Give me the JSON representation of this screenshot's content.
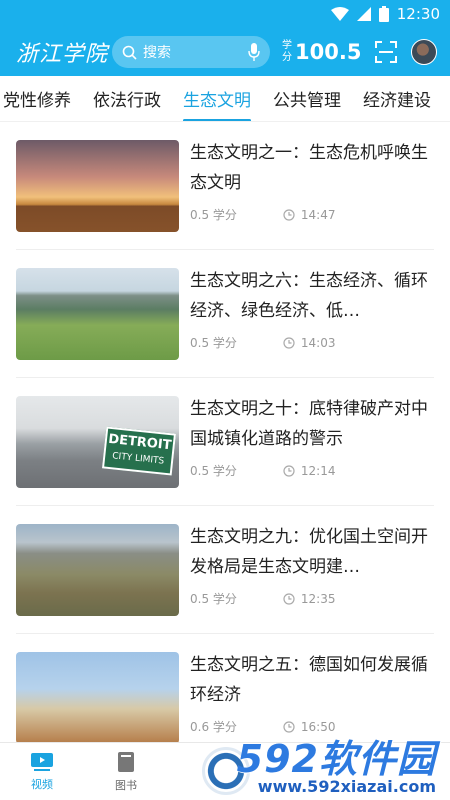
{
  "status": {
    "time": "12:30"
  },
  "header": {
    "logo": "浙江学院",
    "search_placeholder": "搜索",
    "score_label": "学分",
    "score_value": "100.5"
  },
  "tabs": [
    {
      "label": "党性修养",
      "active": false
    },
    {
      "label": "依法行政",
      "active": false
    },
    {
      "label": "生态文明",
      "active": true
    },
    {
      "label": "公共管理",
      "active": false
    },
    {
      "label": "经济建设",
      "active": false
    }
  ],
  "videos": [
    {
      "title": "生态文明之一：生态危机呼唤生态文明",
      "credit": "0.5 学分",
      "duration": "14:47"
    },
    {
      "title": "生态文明之六：生态经济、循环经济、绿色经济、低…",
      "credit": "0.5 学分",
      "duration": "14:03"
    },
    {
      "title": "生态文明之十：底特律破产对中国城镇化道路的警示",
      "credit": "0.5 学分",
      "duration": "12:14",
      "sign_text": [
        "DETROIT",
        "CITY LIMITS"
      ]
    },
    {
      "title": "生态文明之九：优化国土空间开发格局是生态文明建…",
      "credit": "0.5 学分",
      "duration": "12:35"
    },
    {
      "title": "生态文明之五：德国如何发展循环经济",
      "credit": "0.6 学分",
      "duration": "16:50"
    }
  ],
  "tabbar": [
    {
      "label": "视频",
      "icon": "video-icon",
      "active": true
    },
    {
      "label": "图书",
      "icon": "book-icon",
      "active": false
    }
  ],
  "watermark": {
    "big": "592软件园",
    "small": "www.592xiazai.com"
  },
  "colors": {
    "brand": "#1ab0ec",
    "accent": "#1aa3e0"
  }
}
